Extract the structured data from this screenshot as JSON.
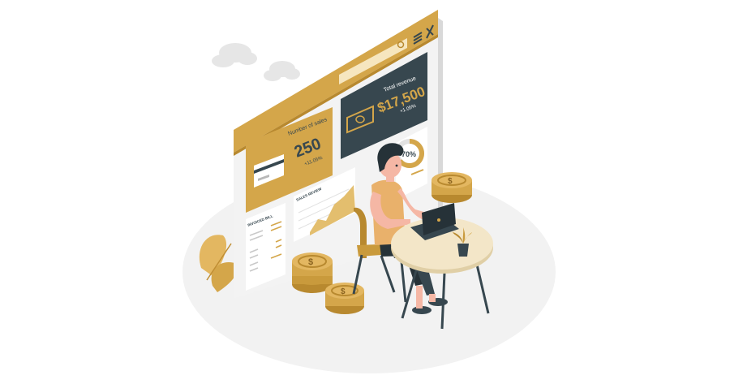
{
  "illustration": {
    "colors": {
      "accent": "#D4A64A",
      "accent_dark": "#B8892F",
      "panel_dark": "#37474F",
      "background_blob": "#F2F2F2",
      "cloud": "#E6E6E6",
      "skin": "#F5B7A5",
      "shirt": "#E9B16B",
      "hair": "#263238",
      "table": "#F3E6C8"
    },
    "window": {
      "menu_icon": "hamburger-icon",
      "close_icon": "close-icon",
      "search_icon": "search-icon"
    },
    "cards": {
      "sales": {
        "title": "Number of sales",
        "value": "250",
        "change": "+11.05%",
        "icon": "credit-card-icon"
      },
      "revenue": {
        "title": "Total revenue",
        "value": "$17,500",
        "change": "+1.05%",
        "icon": "banknote-icon"
      },
      "donut": {
        "value": "70%",
        "fraction": 0.7
      }
    },
    "sales_review": {
      "title": "SALES REVIEW"
    },
    "invoice": {
      "title": "INVOICED BILL"
    }
  }
}
